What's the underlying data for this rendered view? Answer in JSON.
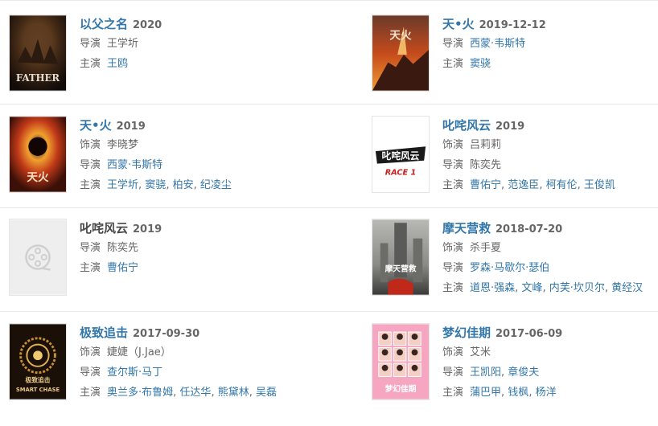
{
  "colors": {
    "link": "#3377aa",
    "muted": "#666666",
    "divider": "#eaeaea"
  },
  "labels": {
    "director": "导演",
    "actor": "主演",
    "role": "饰演"
  },
  "movies": [
    {
      "title": "以父之名",
      "year": "2020",
      "title_link": true,
      "poster": "father-poster",
      "poster_text": "FATHER",
      "role": null,
      "director": {
        "linked": false,
        "names": [
          "王学圻"
        ]
      },
      "cast": [
        "王鸥"
      ]
    },
    {
      "title": "天•火",
      "year": "2019-12-12",
      "title_link": true,
      "poster": "fire-poster-volcano",
      "poster_text": "天火",
      "role": null,
      "director": {
        "linked": true,
        "names": [
          "西蒙·韦斯特"
        ]
      },
      "cast": [
        "窦骁"
      ]
    },
    {
      "title": "天•火",
      "year": "2019",
      "title_link": true,
      "poster": "fire-poster-vortex",
      "poster_text": "天火",
      "role": "李晓梦",
      "director": {
        "linked": true,
        "names": [
          "西蒙·韦斯特"
        ]
      },
      "cast": [
        "王学圻",
        "窦骁",
        "柏安",
        "纪凌尘"
      ]
    },
    {
      "title": "叱咤风云",
      "year": "2019",
      "title_link": true,
      "poster": "race-poster",
      "poster_text": "叱咤风云",
      "poster_subtext": "RACE 1",
      "role": "吕莉莉",
      "director": {
        "linked": false,
        "names": [
          "陈奕先"
        ]
      },
      "cast": [
        "曹佑宁",
        "范逸臣",
        "柯有伦",
        "王俊凯"
      ]
    },
    {
      "title": "叱咤风云",
      "year": "2019",
      "title_link": false,
      "poster": "film-reel-placeholder-icon",
      "role": null,
      "director": {
        "linked": false,
        "names": [
          "陈奕先"
        ]
      },
      "cast": [
        "曹佑宁"
      ]
    },
    {
      "title": "摩天营救",
      "year": "2018-07-20",
      "title_link": true,
      "poster": "skyscraper-poster",
      "poster_text": "摩天营救",
      "role": "杀手夏",
      "director": {
        "linked": true,
        "names": [
          "罗森·马歇尔·瑟伯"
        ]
      },
      "cast": [
        "道恩·强森",
        "文峰",
        "内芙·坎贝尔",
        "黄经汉"
      ]
    },
    {
      "title": "极致追击",
      "year": "2017-09-30",
      "title_link": true,
      "poster": "smart-chase-poster",
      "poster_text": "极致追击",
      "poster_subtext": "SMART CHASE",
      "role": "婕婕（J.Jae）",
      "director": {
        "linked": true,
        "names": [
          "查尔斯·马丁"
        ]
      },
      "cast": [
        "奥兰多·布鲁姆",
        "任达华",
        "熊黛林",
        "吴磊"
      ]
    },
    {
      "title": "梦幻佳期",
      "year": "2017-06-09",
      "title_link": true,
      "poster": "dream-poster",
      "poster_text": "梦幻佳期",
      "role": "艾米",
      "director": {
        "linked": true,
        "names": [
          "王凯阳",
          "章俊夫"
        ]
      },
      "cast": [
        "蒲巴甲",
        "钱枫",
        "杨洋"
      ]
    }
  ]
}
